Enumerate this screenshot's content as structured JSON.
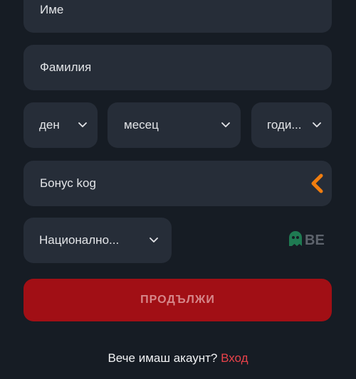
{
  "form": {
    "first_name_placeholder": "Име",
    "last_name_placeholder": "Фамилия",
    "birth_day_label": "ден",
    "birth_month_label": "месец",
    "birth_year_label": "годи...",
    "bonus_code_placeholder": "Бонус kog",
    "nationality_label": "Национално...",
    "continue_label": "ПРОДЪЛЖИ"
  },
  "badge": {
    "text": "BE"
  },
  "footer": {
    "prompt": "Вече имаш акаунт?",
    "login_link": "Вход"
  },
  "colors": {
    "background": "#161c24",
    "field": "#262d38",
    "primary_button": "#a10f15",
    "link": "#e8424a",
    "accent_arrow": "#f07d0f"
  },
  "icons": {
    "dropdown": "chevron-down-icon",
    "bonus_expand": "chevron-left-icon",
    "badge_logo": "ghost-icon"
  }
}
